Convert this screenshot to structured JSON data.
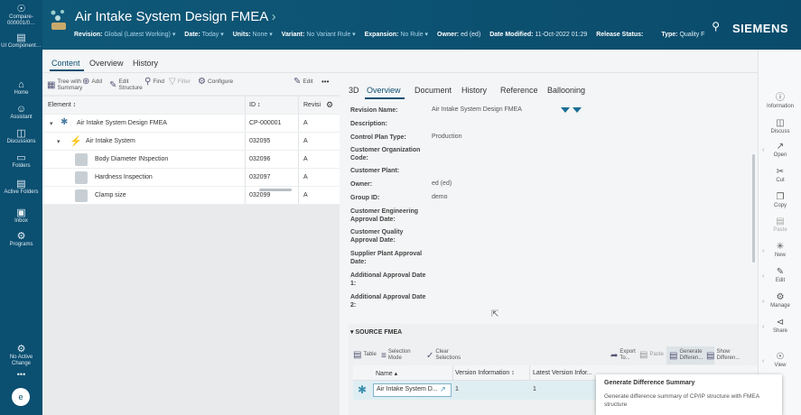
{
  "leftnav": {
    "compare": "Compare-",
    "compare_id": "000001/0…",
    "ui_component": "UI Component…",
    "home": "Home",
    "assistant": "Assistant",
    "discussions": "Discussions",
    "folders": "Folders",
    "active_folders": "Active Folders",
    "inbox": "Inbox",
    "programs": "Programs",
    "no_active_change": "No Active Change",
    "avatar": "e"
  },
  "header": {
    "title": "Air Intake System Design FMEA",
    "title_chevron": "›",
    "revision_label": "Revision:",
    "revision_value": "Global (Latest Working) ▾",
    "date_label": "Date:",
    "date_value": "Today ▾",
    "units_label": "Units:",
    "units_value": "None ▾",
    "variant_label": "Variant:",
    "variant_value": "No Variant Rule ▾",
    "expansion_label": "Expansion:",
    "expansion_value": "No Rule ▾",
    "owner_label": "Owner:",
    "owner_value": "ed (ed)",
    "date_modified_label": "Date Modified:",
    "date_modified_value": "11-Oct-2022 01:29",
    "release_status_label": "Release Status:",
    "type_label": "Type:",
    "type_value": "Quality F",
    "brand": "SIEMENS"
  },
  "primary_tabs": [
    "Content",
    "Overview",
    "History"
  ],
  "left_toolbar": {
    "tree_with_summary": "Tree with Summary",
    "add": "Add",
    "edit_structure": "Edit Structure",
    "find": "Find",
    "filter": "Filter",
    "configure": "Configure",
    "edit": "Edit",
    "more": "•••"
  },
  "tree": {
    "headers": {
      "element": "Element ↕",
      "id": "ID ↕",
      "revision": "Revisi"
    },
    "rows": [
      {
        "name": "Air Intake System Design FMEA",
        "id": "CP-000001",
        "rev": "A"
      },
      {
        "name": "Air Intake System",
        "id": "032095",
        "rev": "A"
      },
      {
        "name": "Body Diameter INspection",
        "id": "032096",
        "rev": "A"
      },
      {
        "name": "Hardness Inspection",
        "id": "032097",
        "rev": "A"
      },
      {
        "name": "Clamp size",
        "id": "032099",
        "rev": "A"
      }
    ]
  },
  "detail_tabs": [
    "3D",
    "Overview",
    "Document",
    "History",
    "Reference",
    "Ballooning"
  ],
  "properties": [
    {
      "label": "Revision Name:",
      "value": "Air Intake System Design FMEA"
    },
    {
      "label": "Description:",
      "value": ""
    },
    {
      "label": "Control Plan Type:",
      "value": "Production"
    },
    {
      "label": "Customer Organization Code:",
      "value": ""
    },
    {
      "label": "Customer Plant:",
      "value": ""
    },
    {
      "label": "Owner:",
      "value": "ed (ed)"
    },
    {
      "label": "Group ID:",
      "value": "demo"
    },
    {
      "label": "Customer Engineering Approval Date:",
      "value": ""
    },
    {
      "label": "Customer Quality Approval Date:",
      "value": ""
    },
    {
      "label": "Supplier Plant Approval Date:",
      "value": ""
    },
    {
      "label": "Additional Approval Date 1:",
      "value": ""
    },
    {
      "label": "Additional Approval Date 2:",
      "value": ""
    }
  ],
  "source_section": {
    "title": "▾ SOURCE FMEA",
    "toolbar": {
      "table": "Table",
      "selection_mode": "Selection Mode",
      "clear_selections": "Clear Selections",
      "export_to": "Export To...",
      "paste": "Paste",
      "generate_difference": "Generate Differen...",
      "show_difference": "Show Differen..."
    },
    "headers": {
      "name": "Name ▴",
      "version_info": "Version Information ↕",
      "latest_version": "Latest Version Infor..."
    },
    "rows": [
      {
        "name": "Air Intake System D...",
        "version_info": "1",
        "latest_version": "1"
      }
    ]
  },
  "right_sidebar": [
    "Information",
    "Discuss",
    "Open",
    "Cut",
    "Copy",
    "Paste",
    "New",
    "Edit",
    "Manage",
    "Share",
    "View"
  ],
  "tooltip": {
    "title": "Generate Difference Summary",
    "description": "Generate difference summary of CP/IP structure with FMEA structure"
  }
}
